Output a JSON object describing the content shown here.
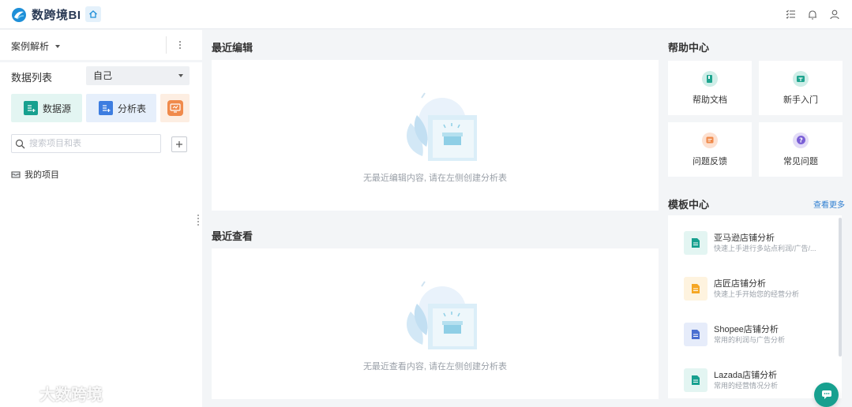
{
  "header": {
    "logo_text": "数跨境BI",
    "brand_color": "#1e8fd8",
    "home_icon": "home-icon",
    "right_icons": [
      "list-icon",
      "bell-icon",
      "user-icon"
    ]
  },
  "sidebar": {
    "project_selector": "案例解析",
    "data_list_title": "数据列表",
    "owner_filter": "自己",
    "buttons": [
      {
        "label": "数据源",
        "icon": "datasource-icon",
        "color": "#17a08f"
      },
      {
        "label": "分析表",
        "icon": "analysis-table-icon",
        "color": "#3d7de0"
      },
      {
        "label": "",
        "icon": "dashboard-icon",
        "color": "#f08a4b"
      }
    ],
    "search_placeholder": "搜索项目和表",
    "tree": [
      {
        "label": "我的项目",
        "icon": "folder-icon"
      }
    ]
  },
  "watermark": "大数跨境",
  "main": {
    "recent_edit": {
      "title": "最近编辑",
      "empty_text": "无最近编辑内容, 请在左侧创建分析表"
    },
    "recent_view": {
      "title": "最近查看",
      "empty_text": "无最近查看内容, 请在左侧创建分析表"
    }
  },
  "help_center": {
    "title": "帮助中心",
    "items": [
      {
        "label": "帮助文档",
        "icon": "document-icon",
        "color": "#1fa58f"
      },
      {
        "label": "新手入门",
        "icon": "guide-icon",
        "color": "#1fa58f"
      },
      {
        "label": "问题反馈",
        "icon": "feedback-icon",
        "color": "#f08a4b"
      },
      {
        "label": "常见问题",
        "icon": "question-icon",
        "color": "#7a5fd6"
      }
    ]
  },
  "template_center": {
    "title": "模板中心",
    "more_label": "查看更多",
    "items": [
      {
        "name": "亚马逊店铺分析",
        "desc": "快速上手进行多站点利润/广告/...",
        "color": "#17a08f"
      },
      {
        "name": "店匠店铺分析",
        "desc": "快速上手开始您的经营分析",
        "color": "#f5a623"
      },
      {
        "name": "Shopee店铺分析",
        "desc": "常用的利润与广告分析",
        "color": "#4a6fd1"
      },
      {
        "name": "Lazada店铺分析",
        "desc": "常用的经营情况分析",
        "color": "#17a08f"
      }
    ]
  }
}
